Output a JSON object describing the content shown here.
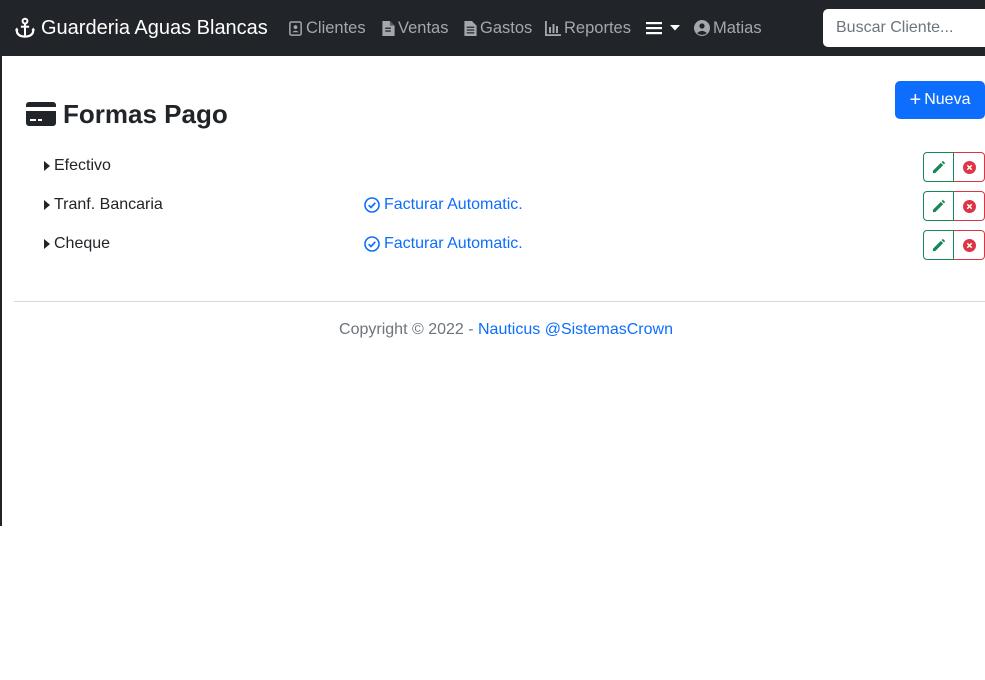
{
  "navbar": {
    "brand": "Guarderia Aguas Blancas",
    "items": [
      {
        "label": "Clientes",
        "icon": "contact-card-icon"
      },
      {
        "label": "Ventas",
        "icon": "file-invoice-icon"
      },
      {
        "label": "Gastos",
        "icon": "file-text-icon"
      },
      {
        "label": "Reportes",
        "icon": "bar-chart-icon"
      }
    ],
    "menu_icon": "hamburger-icon",
    "user": "Matias",
    "search_placeholder": "Buscar Cliente..."
  },
  "page": {
    "title": "Formas Pago",
    "new_button": "Nueva"
  },
  "payment_methods": [
    {
      "name": "Efectivo",
      "flag": ""
    },
    {
      "name": "Tranf. Bancaria",
      "flag": "Facturar Automatic."
    },
    {
      "name": "Cheque",
      "flag": "Facturar Automatic."
    }
  ],
  "footer": {
    "prefix": "Copyright © 2022 - ",
    "link": "Nauticus @SistemasCrown"
  },
  "colors": {
    "navbar": "#212529",
    "primary": "#0d6efd",
    "success": "#198754",
    "danger": "#dc3545"
  }
}
